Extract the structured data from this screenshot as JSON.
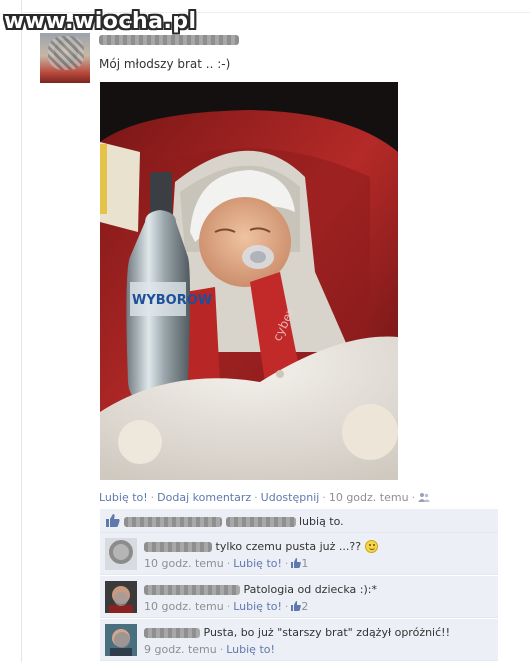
{
  "watermark": "www.wiocha.pl",
  "post": {
    "text": "Mój młodszy brat .. :-)",
    "actions": {
      "like": "Lubię to!",
      "comment": "Dodaj komentarz",
      "share": "Udostępnij",
      "time": "10 godz. temu"
    }
  },
  "likes": {
    "text": "lubią to."
  },
  "comments": [
    {
      "text": "tylko czemu pusta już ...??",
      "time": "10 godz. temu",
      "like": "Lubię to!",
      "like_count": "1"
    },
    {
      "text": "Patologia od dziecka :):*",
      "time": "10 godz. temu",
      "like": "Lubię to!",
      "like_count": "2"
    },
    {
      "text": "Pusta, bo już \"starszy brat\" zdążył opróżnić!!",
      "time": "9 godz. temu",
      "like": "Lubię to!",
      "like_count": ""
    }
  ],
  "separator": "·",
  "colors": {
    "link": "#5f79ad",
    "ufi_bg": "#eceff5",
    "meta": "#8f8f8f"
  },
  "icons": [
    "people-icon",
    "thumbs-up-icon",
    "smiley-icon"
  ]
}
